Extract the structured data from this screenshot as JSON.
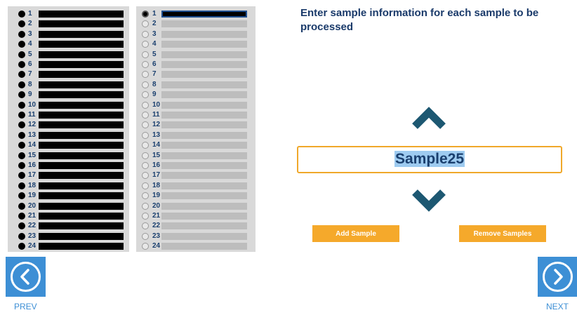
{
  "left_list": {
    "items": [
      "1",
      "2",
      "3",
      "4",
      "5",
      "6",
      "7",
      "8",
      "9",
      "10",
      "11",
      "12",
      "13",
      "14",
      "15",
      "16",
      "17",
      "18",
      "19",
      "20",
      "21",
      "22",
      "23",
      "24"
    ]
  },
  "right_list": {
    "items": [
      "1",
      "2",
      "3",
      "4",
      "5",
      "6",
      "7",
      "8",
      "9",
      "10",
      "11",
      "12",
      "13",
      "14",
      "15",
      "16",
      "17",
      "18",
      "19",
      "20",
      "21",
      "22",
      "23",
      "24"
    ],
    "selected": "1"
  },
  "instructions": "Enter sample information for each sample to be processed",
  "sample": {
    "value": "Sample25"
  },
  "buttons": {
    "add_sample": "Add Sample",
    "remove_samples": "Remove Samples"
  },
  "nav": {
    "prev_label": "PREV",
    "next_label": "NEXT"
  },
  "icons": {
    "up": "chevron-up-icon",
    "down": "chevron-down-icon",
    "prev": "circle-arrow-left-icon",
    "next": "circle-arrow-right-icon"
  },
  "colors": {
    "accent_orange": "#f5a92b",
    "nav_blue": "#3d8fd5",
    "chevron_teal": "#1d5872",
    "text_navy": "#1a3a6a"
  }
}
